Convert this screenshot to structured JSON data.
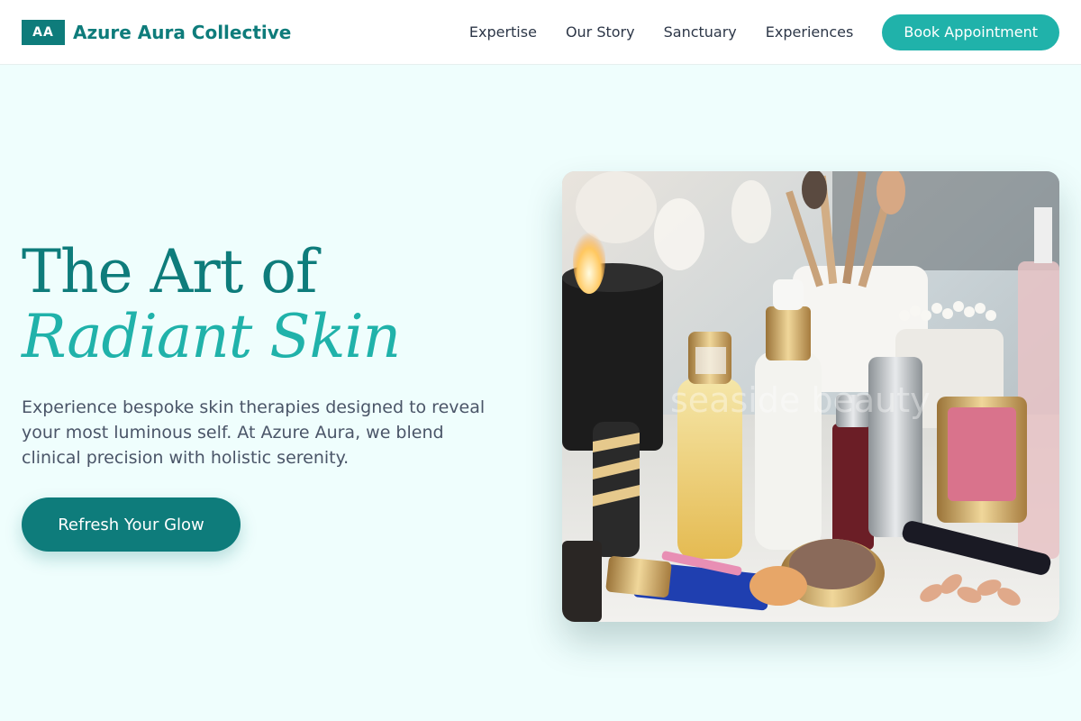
{
  "brand": {
    "logo_text": "AA",
    "name": "Azure Aura Collective"
  },
  "nav": {
    "links": [
      "Expertise",
      "Our Story",
      "Sanctuary",
      "Experiences"
    ],
    "cta_label": "Book Appointment"
  },
  "hero": {
    "title_line1": "The Art of",
    "title_line2": "Radiant Skin",
    "description": "Experience bespoke skin therapies designed to reveal your most luminous self. At Azure Aura, we blend clinical precision with holistic serenity.",
    "cta_label": "Refresh Your Glow",
    "image": {
      "subject": "beauty products on vanity: serums, brushes, candle, blush compact, cotton swabs",
      "watermark_text": "seaside beauty"
    }
  },
  "colors": {
    "primary": "#0e7c7b",
    "accent": "#20b2aa",
    "background": "#effefd"
  }
}
